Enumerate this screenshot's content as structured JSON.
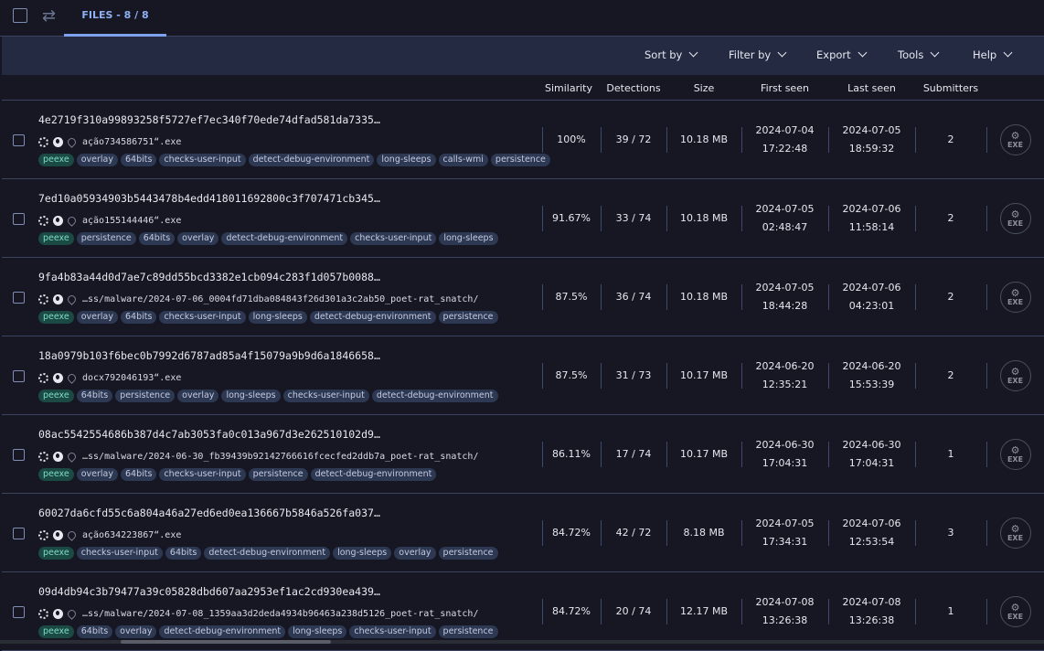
{
  "tab": {
    "label": "FILES - 8 / 8"
  },
  "toolbar": {
    "sort": "Sort by",
    "filter": "Filter by",
    "export": "Export",
    "tools": "Tools",
    "help": "Help"
  },
  "columns": {
    "similarity": "Similarity",
    "detections": "Detections",
    "size": "Size",
    "first_seen": "First seen",
    "last_seen": "Last seen",
    "submitters": "Submitters"
  },
  "file_type_icon": {
    "label": "EXE"
  },
  "rows": [
    {
      "hash": "4e2719f310a99893258f5727ef7ec340f70ede74dfad581da7335…",
      "name": "ação734586751“.exe",
      "tags": [
        "peexe",
        "overlay",
        "64bits",
        "checks-user-input",
        "detect-debug-environment",
        "long-sleeps",
        "calls-wmi",
        "persistence"
      ],
      "similarity": "100%",
      "detections": "39  / 72",
      "size": "10.18 MB",
      "first_date": "2024-07-04",
      "first_time": "17:22:48",
      "last_date": "2024-07-05",
      "last_time": "18:59:32",
      "submitters": "2"
    },
    {
      "hash": "7ed10a05934903b5443478b4edd418011692800c3f707471cb345…",
      "name": "ação155144446“.exe",
      "tags": [
        "peexe",
        "persistence",
        "64bits",
        "overlay",
        "detect-debug-environment",
        "checks-user-input",
        "long-sleeps"
      ],
      "similarity": "91.67%",
      "detections": "33  / 74",
      "size": "10.18 MB",
      "first_date": "2024-07-05",
      "first_time": "02:48:47",
      "last_date": "2024-07-06",
      "last_time": "11:58:14",
      "submitters": "2"
    },
    {
      "hash": "9fa4b83a44d0d7ae7c89dd55bcd3382e1cb094c283f1d057b0088…",
      "name": "…ss/malware/2024-07-06_0004fd71dba084843f26d301a3c2ab50_poet-rat_snatch/",
      "tags": [
        "peexe",
        "overlay",
        "64bits",
        "checks-user-input",
        "long-sleeps",
        "detect-debug-environment",
        "persistence"
      ],
      "similarity": "87.5%",
      "detections": "36  / 74",
      "size": "10.18 MB",
      "first_date": "2024-07-05",
      "first_time": "18:44:28",
      "last_date": "2024-07-06",
      "last_time": "04:23:01",
      "submitters": "2"
    },
    {
      "hash": "18a0979b103f6bec0b7992d6787ad85a4f15079a9b9d6a1846658…",
      "name": "docx792046193“.exe",
      "tags": [
        "peexe",
        "64bits",
        "persistence",
        "overlay",
        "long-sleeps",
        "checks-user-input",
        "detect-debug-environment"
      ],
      "similarity": "87.5%",
      "detections": "31  / 73",
      "size": "10.17 MB",
      "first_date": "2024-06-20",
      "first_time": "12:35:21",
      "last_date": "2024-06-20",
      "last_time": "15:53:39",
      "submitters": "2"
    },
    {
      "hash": "08ac5542554686b387d4c7ab3053fa0c013a967d3e262510102d9…",
      "name": "…ss/malware/2024-06-30_fb39439b92142766616fcecfed2ddb7a_poet-rat_snatch/",
      "tags": [
        "peexe",
        "overlay",
        "64bits",
        "checks-user-input",
        "persistence",
        "detect-debug-environment"
      ],
      "similarity": "86.11%",
      "detections": "17  / 74",
      "size": "10.17 MB",
      "first_date": "2024-06-30",
      "first_time": "17:04:31",
      "last_date": "2024-06-30",
      "last_time": "17:04:31",
      "submitters": "1"
    },
    {
      "hash": "60027da6cfd55c6a804a46a27ed6ed0ea136667b5846a526fa037…",
      "name": "ação634223867“.exe",
      "tags": [
        "peexe",
        "checks-user-input",
        "64bits",
        "detect-debug-environment",
        "long-sleeps",
        "overlay",
        "persistence"
      ],
      "similarity": "84.72%",
      "detections": "42  / 72",
      "size": "8.18 MB",
      "first_date": "2024-07-05",
      "first_time": "17:34:31",
      "last_date": "2024-07-06",
      "last_time": "12:53:54",
      "submitters": "3"
    },
    {
      "hash": "09d4db94c3b79477a39c05828dbd607aa2953ef1ac2cd930ea439…",
      "name": "…ss/malware/2024-07-08_1359aa3d2deda4934b96463a238d5126_poet-rat_snatch/",
      "tags": [
        "peexe",
        "64bits",
        "overlay",
        "detect-debug-environment",
        "long-sleeps",
        "checks-user-input",
        "persistence"
      ],
      "similarity": "84.72%",
      "detections": "20  / 74",
      "size": "12.17 MB",
      "first_date": "2024-07-08",
      "first_time": "13:26:38",
      "last_date": "2024-07-08",
      "last_time": "13:26:38",
      "submitters": "1"
    }
  ]
}
